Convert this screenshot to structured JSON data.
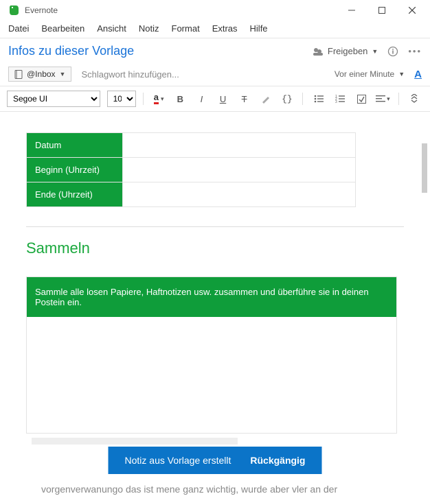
{
  "app": {
    "name": "Evernote"
  },
  "menubar": [
    "Datei",
    "Bearbeiten",
    "Ansicht",
    "Notiz",
    "Format",
    "Extras",
    "Hilfe"
  ],
  "header": {
    "title": "Infos zu dieser Vorlage",
    "share_label": "Freigeben"
  },
  "notebook": {
    "name": "@Inbox",
    "tags_placeholder": "Schlagwort hinzufügen...",
    "updated": "Vor einer Minute"
  },
  "toolbar": {
    "font": "Segoe UI",
    "size": "10"
  },
  "content": {
    "table": [
      "Datum",
      "Beginn (Uhrzeit)",
      "Ende (Uhrzeit)"
    ],
    "heading": "Sammeln",
    "banner": "Sammle alle losen Papiere, Haftnotizen usw. zusammen und überführe sie in deinen Postein ein."
  },
  "toast": {
    "message": "Notiz aus Vorlage erstellt",
    "undo": "Rückgängig"
  },
  "footer_cut": "vorgenverwanungo das ist mene ganz wichtig, wurde aber vler an der"
}
